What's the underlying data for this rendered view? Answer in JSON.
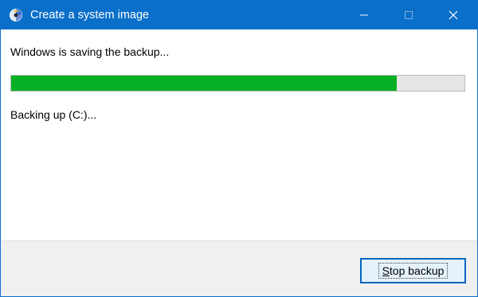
{
  "window": {
    "title": "Create a system image",
    "icon": "system-image-icon",
    "controls": [
      "minimize-icon",
      "maximize-icon",
      "close-icon"
    ]
  },
  "main": {
    "status_text": "Windows is saving the backup...",
    "progress_percent": 85,
    "progress_color": "#06b025",
    "detail_text": "Backing up (C:)..."
  },
  "footer": {
    "stop_button": {
      "mnemonic": "S",
      "rest": "top backup"
    }
  },
  "colors": {
    "titlebar": "#0a6fc9",
    "footer_bg": "#f0f0f0"
  }
}
